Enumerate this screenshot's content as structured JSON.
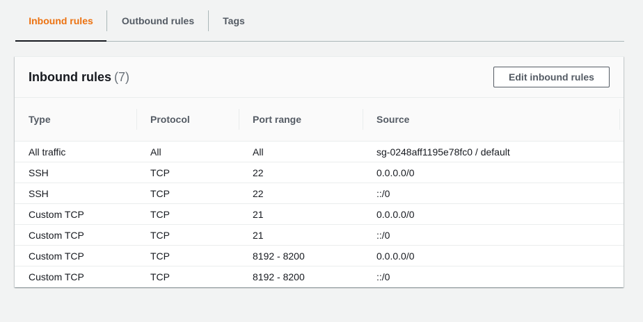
{
  "tabs": [
    {
      "label": "Inbound rules",
      "active": true
    },
    {
      "label": "Outbound rules",
      "active": false
    },
    {
      "label": "Tags",
      "active": false
    }
  ],
  "panel": {
    "title": "Inbound rules",
    "count": "(7)",
    "edit_button_label": "Edit inbound rules"
  },
  "table": {
    "columns": [
      "Type",
      "Protocol",
      "Port range",
      "Source"
    ],
    "rows": [
      [
        "All traffic",
        "All",
        "All",
        "sg-0248aff1195e78fc0 / default"
      ],
      [
        "SSH",
        "TCP",
        "22",
        "0.0.0.0/0"
      ],
      [
        "SSH",
        "TCP",
        "22",
        "::/0"
      ],
      [
        "Custom TCP",
        "TCP",
        "21",
        "0.0.0.0/0"
      ],
      [
        "Custom TCP",
        "TCP",
        "21",
        "::/0"
      ],
      [
        "Custom TCP",
        "TCP",
        "8192 - 8200",
        "0.0.0.0/0"
      ],
      [
        "Custom TCP",
        "TCP",
        "8192 - 8200",
        "::/0"
      ]
    ]
  },
  "colors": {
    "accent": "#ec7211",
    "text": "#16191f",
    "muted": "#545b64",
    "background": "#f2f3f3"
  }
}
